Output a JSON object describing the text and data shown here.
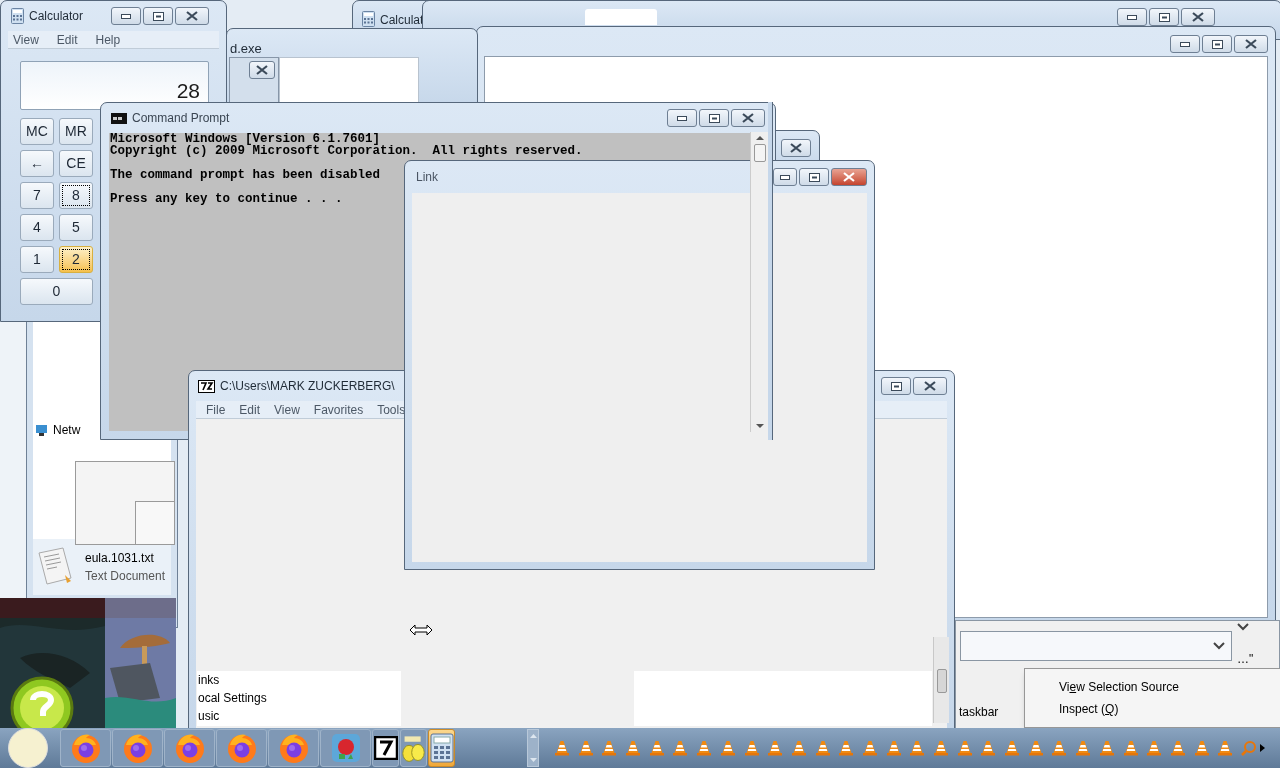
{
  "background_calculator": {
    "title": "Calculat"
  },
  "exe_window": {
    "title": "d.exe"
  },
  "explorer": {
    "items": [
      {
        "name": "Netw"
      }
    ],
    "file": {
      "name": "eula.1031.txt",
      "type": "Text Document"
    }
  },
  "calculator": {
    "title": "Calculator",
    "active": false,
    "menu": [
      "View",
      "Edit",
      "Help"
    ],
    "display": "28",
    "keys": [
      {
        "label": "MC",
        "focused": false,
        "hot": false,
        "wide": false
      },
      {
        "label": "MR",
        "focused": false,
        "hot": false,
        "wide": false
      },
      {
        "label": "←",
        "focused": false,
        "hot": false,
        "wide": false
      },
      {
        "label": "CE",
        "focused": false,
        "hot": false,
        "wide": false
      },
      {
        "label": "7",
        "focused": false,
        "hot": false,
        "wide": false
      },
      {
        "label": "8",
        "focused": true,
        "hot": false,
        "wide": false
      },
      {
        "label": "4",
        "focused": false,
        "hot": false,
        "wide": false
      },
      {
        "label": "5",
        "focused": false,
        "hot": false,
        "wide": false
      },
      {
        "label": "1",
        "focused": false,
        "hot": false,
        "wide": false
      },
      {
        "label": "2",
        "focused": true,
        "hot": true,
        "wide": false
      },
      {
        "label": "0",
        "focused": false,
        "hot": false,
        "wide": true
      }
    ]
  },
  "command_prompt": {
    "title": "Command Prompt",
    "active": false,
    "paragraphs": [
      [
        "Microsoft Windows [Version 6.1.7601]",
        "Copyright (c) 2009 Microsoft Corporation.  All rights reserved."
      ],
      [
        "The command prompt has been disabled"
      ],
      [
        "Press any key to continue . . ."
      ]
    ]
  },
  "seven_zip": {
    "title": "C:\\Users\\MARK ZUCKERBERG\\",
    "active": false,
    "menu": [
      "File",
      "Edit",
      "View",
      "Favorites",
      "Tools"
    ],
    "rows": [
      "inks",
      "ocal Settings",
      "usic"
    ]
  },
  "link_window": {
    "title": "Link",
    "active": true
  },
  "bottom_right": {
    "label": "taskbar",
    "fragment": "…\"",
    "context_menu": [
      {
        "before": "Vi",
        "key": "e",
        "after": "w Selection Source"
      },
      {
        "before": "Inspect (",
        "key": "Q",
        "after": ")"
      }
    ]
  },
  "taskbar": {
    "buttons": [
      {
        "kind": "firefox",
        "selected": false
      },
      {
        "kind": "firefox",
        "selected": false
      },
      {
        "kind": "firefox",
        "selected": false
      },
      {
        "kind": "firefox",
        "selected": false
      },
      {
        "kind": "firefox",
        "selected": false
      },
      {
        "kind": "game",
        "selected": false
      },
      {
        "kind": "archiver",
        "selected": false
      },
      {
        "kind": "lemon",
        "selected": false
      },
      {
        "kind": "calculator",
        "selected": true
      }
    ],
    "tray": [
      {
        "kind": "cone"
      },
      {
        "kind": "cone"
      },
      {
        "kind": "cone"
      },
      {
        "kind": "cone"
      },
      {
        "kind": "cone"
      },
      {
        "kind": "cone"
      },
      {
        "kind": "cone"
      },
      {
        "kind": "cone"
      },
      {
        "kind": "cone"
      },
      {
        "kind": "cone"
      },
      {
        "kind": "cone"
      },
      {
        "kind": "cone"
      },
      {
        "kind": "cone"
      },
      {
        "kind": "cone"
      },
      {
        "kind": "cone"
      },
      {
        "kind": "cone"
      },
      {
        "kind": "cone"
      },
      {
        "kind": "cone"
      },
      {
        "kind": "cone"
      },
      {
        "kind": "cone"
      },
      {
        "kind": "cone"
      },
      {
        "kind": "cone"
      },
      {
        "kind": "cone"
      },
      {
        "kind": "cone"
      },
      {
        "kind": "cone"
      },
      {
        "kind": "cone"
      },
      {
        "kind": "cone"
      },
      {
        "kind": "cone"
      },
      {
        "kind": "cone"
      }
    ]
  }
}
